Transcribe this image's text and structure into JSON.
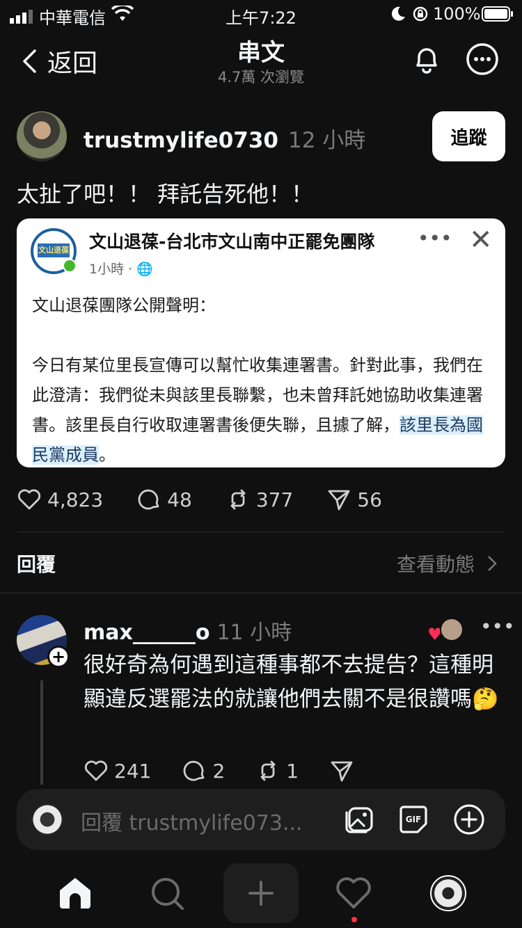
{
  "status_bar": {
    "carrier": "中華電信",
    "time": "上午7:22",
    "battery": "100%"
  },
  "header": {
    "back_label": "返回",
    "title": "串文",
    "views": "4.7萬 次瀏覽",
    "icons": [
      "bell-icon",
      "more-icon"
    ]
  },
  "post": {
    "username": "trustmylife0730",
    "time": "12 小時",
    "follow_label": "追蹤",
    "text": "太扯了吧！！ 拜託告死他！！",
    "embed": {
      "page_name": "文山退葆-台北市文山南中正罷免團隊",
      "logo_text": "文山退葆",
      "meta": "1小時 · ",
      "body_main": "文山退葆團隊公開聲明：\n\n今日有某位里長宣傳可以幫忙收集連署書。針對此事，我們在此澄清：我們從未與該里長聯繫，也未曾拜託她協助收集連署書。該里長自行收取連署書後便失聯，且據了解，",
      "body_highlight": "該里長為國民黨成員",
      "body_end": "。"
    },
    "stats": {
      "likes": "4,823",
      "comments": "48",
      "reposts": "377",
      "shares": "56"
    }
  },
  "replies_bar": {
    "label": "回覆",
    "activity": "查看動態"
  },
  "reply": {
    "username": "max______o",
    "time": "11 小時",
    "text": "很好奇為何遇到這種事都不去提告？這種明顯違反選罷法的就讓他們去關不是很讚嗎🤔",
    "stats": {
      "likes": "241",
      "comments": "2",
      "reposts": "1"
    }
  },
  "composer": {
    "placeholder": "回覆 trustmylife073..."
  },
  "tabbar": {
    "icons": [
      "home-icon",
      "search-icon",
      "new-post-icon",
      "activity-heart-icon",
      "profile-avatar"
    ]
  }
}
